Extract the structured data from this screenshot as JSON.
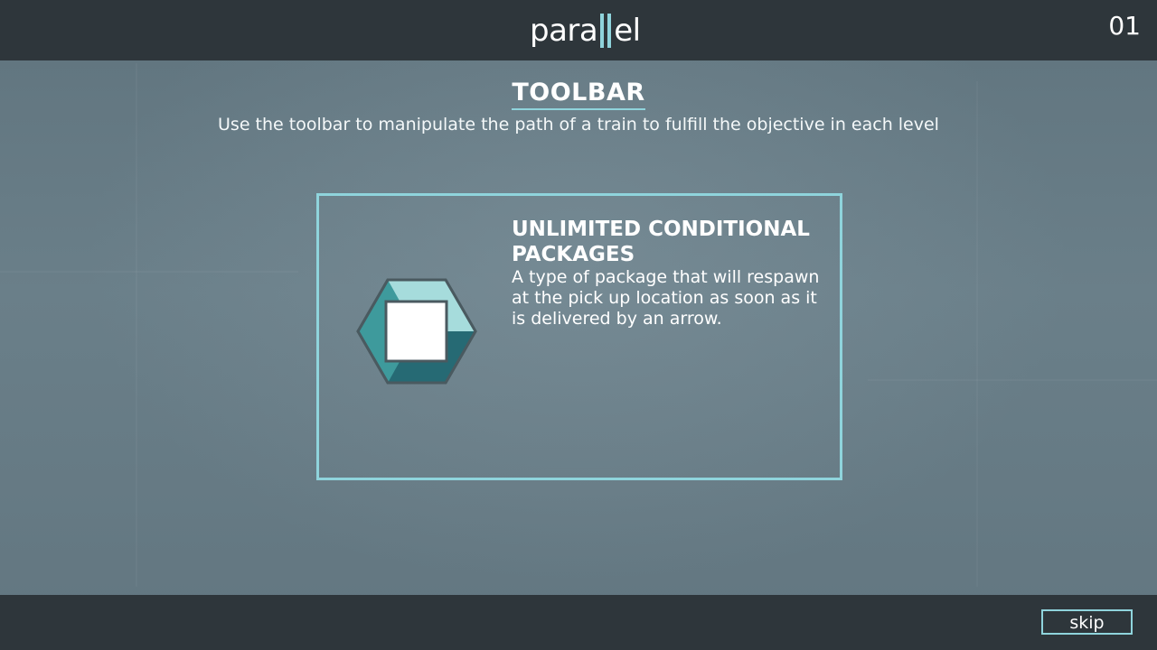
{
  "header": {
    "logo_left": "para",
    "logo_right": "el",
    "level_number": "01"
  },
  "section": {
    "title": "TOOLBAR",
    "subtitle": "Use the toolbar to manipulate the path of a train to fulfill the objective in each level"
  },
  "card": {
    "icon": "package-hexagon-icon",
    "title": "UNLIMITED CONDITIONAL PACKAGES",
    "description": "A type of package that will respawn at the pick up location as soon as it is delivered by an arrow."
  },
  "footer": {
    "skip_label": "skip"
  },
  "colors": {
    "accent": "#8fd4dc",
    "bar_background": "#2e363b",
    "page_background": "#6a7e88",
    "hex_light": "#a6dcdc",
    "hex_mid": "#3e9a9c",
    "hex_dark": "#266a74",
    "hex_border": "#4a5a60"
  }
}
